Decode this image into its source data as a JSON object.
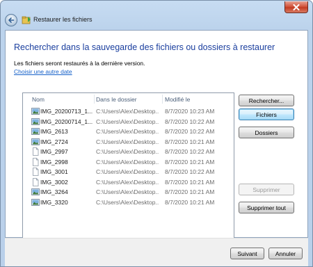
{
  "window": {
    "title": "Restaurer les fichiers"
  },
  "header": {
    "heading": "Rechercher dans la sauvegarde des fichiers ou dossiers à restaurer",
    "info": "Les fichiers seront restaurés à la dernière version.",
    "choose_date_link": "Choisir une autre date"
  },
  "list": {
    "columns": [
      "Nom",
      "Dans le dossier",
      "Modifié le"
    ],
    "rows": [
      {
        "name": "IMG_20200713_1...",
        "folder": "C:\\Users\\Alex\\Desktop...",
        "modified": "8/7/2020 10:23 AM",
        "icon": "image-file-icon"
      },
      {
        "name": "IMG_20200714_1...",
        "folder": "C:\\Users\\Alex\\Desktop...",
        "modified": "8/7/2020 10:22 AM",
        "icon": "image-file-icon"
      },
      {
        "name": "IMG_2613",
        "folder": "C:\\Users\\Alex\\Desktop...",
        "modified": "8/7/2020 10:22 AM",
        "icon": "image-file-icon"
      },
      {
        "name": "IMG_2724",
        "folder": "C:\\Users\\Alex\\Desktop...",
        "modified": "8/7/2020 10:21 AM",
        "icon": "image-file-icon"
      },
      {
        "name": "IMG_2997",
        "folder": "C:\\Users\\Alex\\Desktop...",
        "modified": "8/7/2020 10:22 AM",
        "icon": "blank-file-icon"
      },
      {
        "name": "IMG_2998",
        "folder": "C:\\Users\\Alex\\Desktop...",
        "modified": "8/7/2020 10:21 AM",
        "icon": "blank-file-icon"
      },
      {
        "name": "IMG_3001",
        "folder": "C:\\Users\\Alex\\Desktop...",
        "modified": "8/7/2020 10:22 AM",
        "icon": "blank-file-icon"
      },
      {
        "name": "IMG_3002",
        "folder": "C:\\Users\\Alex\\Desktop...",
        "modified": "8/7/2020 10:21 AM",
        "icon": "blank-file-icon"
      },
      {
        "name": "IMG_3264",
        "folder": "C:\\Users\\Alex\\Desktop...",
        "modified": "8/7/2020 10:21 AM",
        "icon": "image-file-icon"
      },
      {
        "name": "IMG_3320",
        "folder": "C:\\Users\\Alex\\Desktop...",
        "modified": "8/7/2020 10:21 AM",
        "icon": "image-file-icon"
      }
    ]
  },
  "actions": {
    "search": "Rechercher...",
    "files": "Fichiers",
    "folders": "Dossiers",
    "remove": "Supprimer",
    "remove_all": "Supprimer tout"
  },
  "footer": {
    "next": "Suivant",
    "cancel": "Annuler"
  },
  "colors": {
    "heading": "#1a3e9e",
    "link": "#1560c9",
    "default_button_border": "#3c7fb1"
  }
}
